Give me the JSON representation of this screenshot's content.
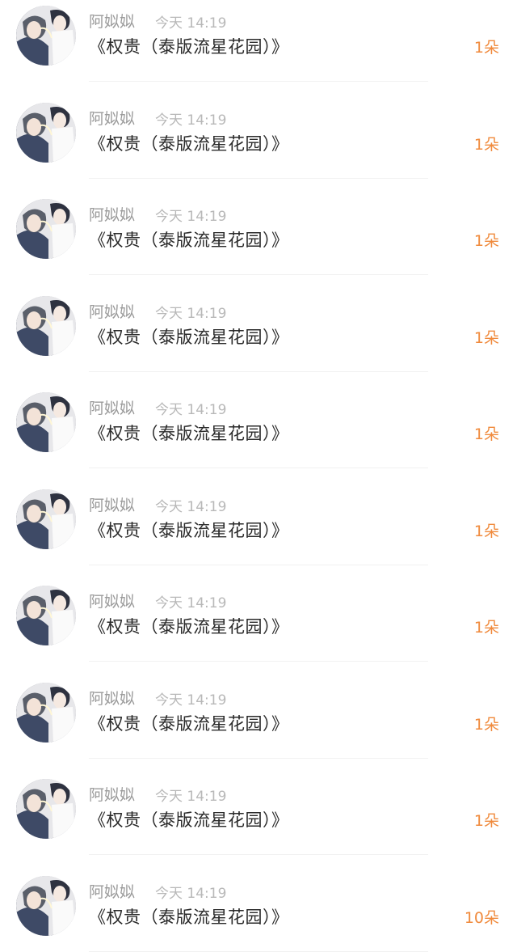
{
  "colors": {
    "accent": "#f08a3c",
    "username": "#9b9b9b",
    "time": "#b8b8b8",
    "title": "#2a2a2a",
    "divider": "#f1f1f1"
  },
  "avatar_icon": "anime-portrait-avatar-icon",
  "items": [
    {
      "username": "阿姒姒",
      "time": "今天 14:19",
      "title": "《权贵（泰版流星花园）》",
      "amount": "1朵"
    },
    {
      "username": "阿姒姒",
      "time": "今天 14:19",
      "title": "《权贵（泰版流星花园）》",
      "amount": "1朵"
    },
    {
      "username": "阿姒姒",
      "time": "今天 14:19",
      "title": "《权贵（泰版流星花园）》",
      "amount": "1朵"
    },
    {
      "username": "阿姒姒",
      "time": "今天 14:19",
      "title": "《权贵（泰版流星花园）》",
      "amount": "1朵"
    },
    {
      "username": "阿姒姒",
      "time": "今天 14:19",
      "title": "《权贵（泰版流星花园）》",
      "amount": "1朵"
    },
    {
      "username": "阿姒姒",
      "time": "今天 14:19",
      "title": "《权贵（泰版流星花园）》",
      "amount": "1朵"
    },
    {
      "username": "阿姒姒",
      "time": "今天 14:19",
      "title": "《权贵（泰版流星花园）》",
      "amount": "1朵"
    },
    {
      "username": "阿姒姒",
      "time": "今天 14:19",
      "title": "《权贵（泰版流星花园）》",
      "amount": "1朵"
    },
    {
      "username": "阿姒姒",
      "time": "今天 14:19",
      "title": "《权贵（泰版流星花园）》",
      "amount": "1朵"
    },
    {
      "username": "阿姒姒",
      "time": "今天 14:19",
      "title": "《权贵（泰版流星花园）》",
      "amount": "10朵"
    }
  ]
}
